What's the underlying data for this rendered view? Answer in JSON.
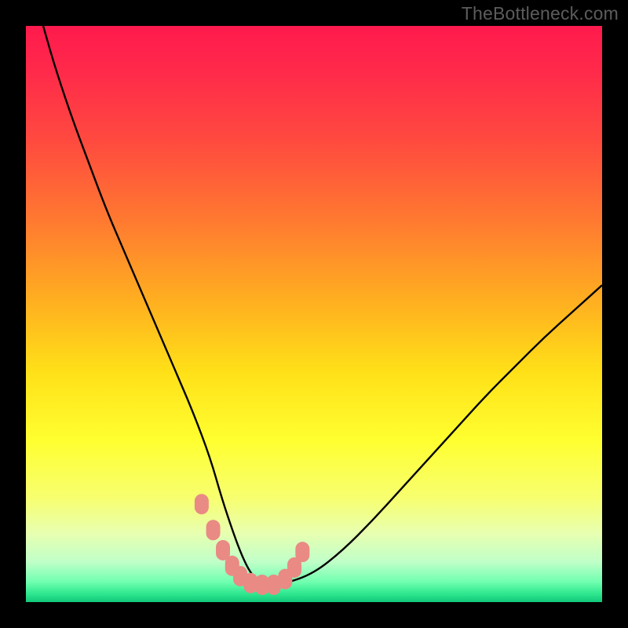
{
  "watermark": "TheBottleneck.com",
  "colors": {
    "background": "#000000",
    "watermark_text": "#5c5c5c",
    "gradient_stops": [
      {
        "offset": 0.0,
        "color": "#ff1a4d"
      },
      {
        "offset": 0.08,
        "color": "#ff2a4a"
      },
      {
        "offset": 0.2,
        "color": "#ff4a3f"
      },
      {
        "offset": 0.34,
        "color": "#ff7a30"
      },
      {
        "offset": 0.48,
        "color": "#ffb020"
      },
      {
        "offset": 0.6,
        "color": "#ffe018"
      },
      {
        "offset": 0.72,
        "color": "#ffff30"
      },
      {
        "offset": 0.82,
        "color": "#f7ff70"
      },
      {
        "offset": 0.88,
        "color": "#e8ffb0"
      },
      {
        "offset": 0.93,
        "color": "#c0ffc8"
      },
      {
        "offset": 0.965,
        "color": "#70ffb0"
      },
      {
        "offset": 0.985,
        "color": "#30e890"
      },
      {
        "offset": 1.0,
        "color": "#10c878"
      }
    ],
    "curve_stroke": "#000000",
    "marker_fill": "#e98a85",
    "marker_stroke": "#c86a65"
  },
  "chart_data": {
    "type": "line",
    "title": "",
    "xlabel": "",
    "ylabel": "",
    "xlim": [
      0,
      100
    ],
    "ylim": [
      0,
      100
    ],
    "legend": false,
    "grid": false,
    "series": [
      {
        "name": "bottleneck-curve",
        "x": [
          3,
          5,
          8,
          11,
          14,
          17,
          20,
          23,
          26,
          29,
          32,
          34,
          36,
          37.5,
          39,
          40.5,
          42,
          45,
          50,
          55,
          60,
          65,
          70,
          75,
          80,
          85,
          90,
          95,
          100
        ],
        "y": [
          100,
          93,
          84,
          76,
          68,
          61,
          54,
          47,
          40,
          33,
          25,
          18,
          12,
          8,
          5,
          3.5,
          3,
          3.2,
          5,
          9,
          14,
          19.5,
          25,
          30.5,
          36,
          41,
          46,
          50.5,
          55
        ]
      }
    ],
    "markers": {
      "name": "highlighted-points",
      "shape": "rounded-rect",
      "x": [
        30.5,
        32.5,
        34.2,
        35.8,
        37.2,
        39.0,
        41.0,
        43.0,
        45.0,
        46.6,
        48.0
      ],
      "y": [
        17.0,
        12.5,
        9.0,
        6.3,
        4.5,
        3.3,
        3.0,
        3.0,
        4.0,
        6.0,
        8.7
      ]
    },
    "precision_note": "x and y are in percent of plot area; values estimated from pixels since no axes are shown"
  }
}
